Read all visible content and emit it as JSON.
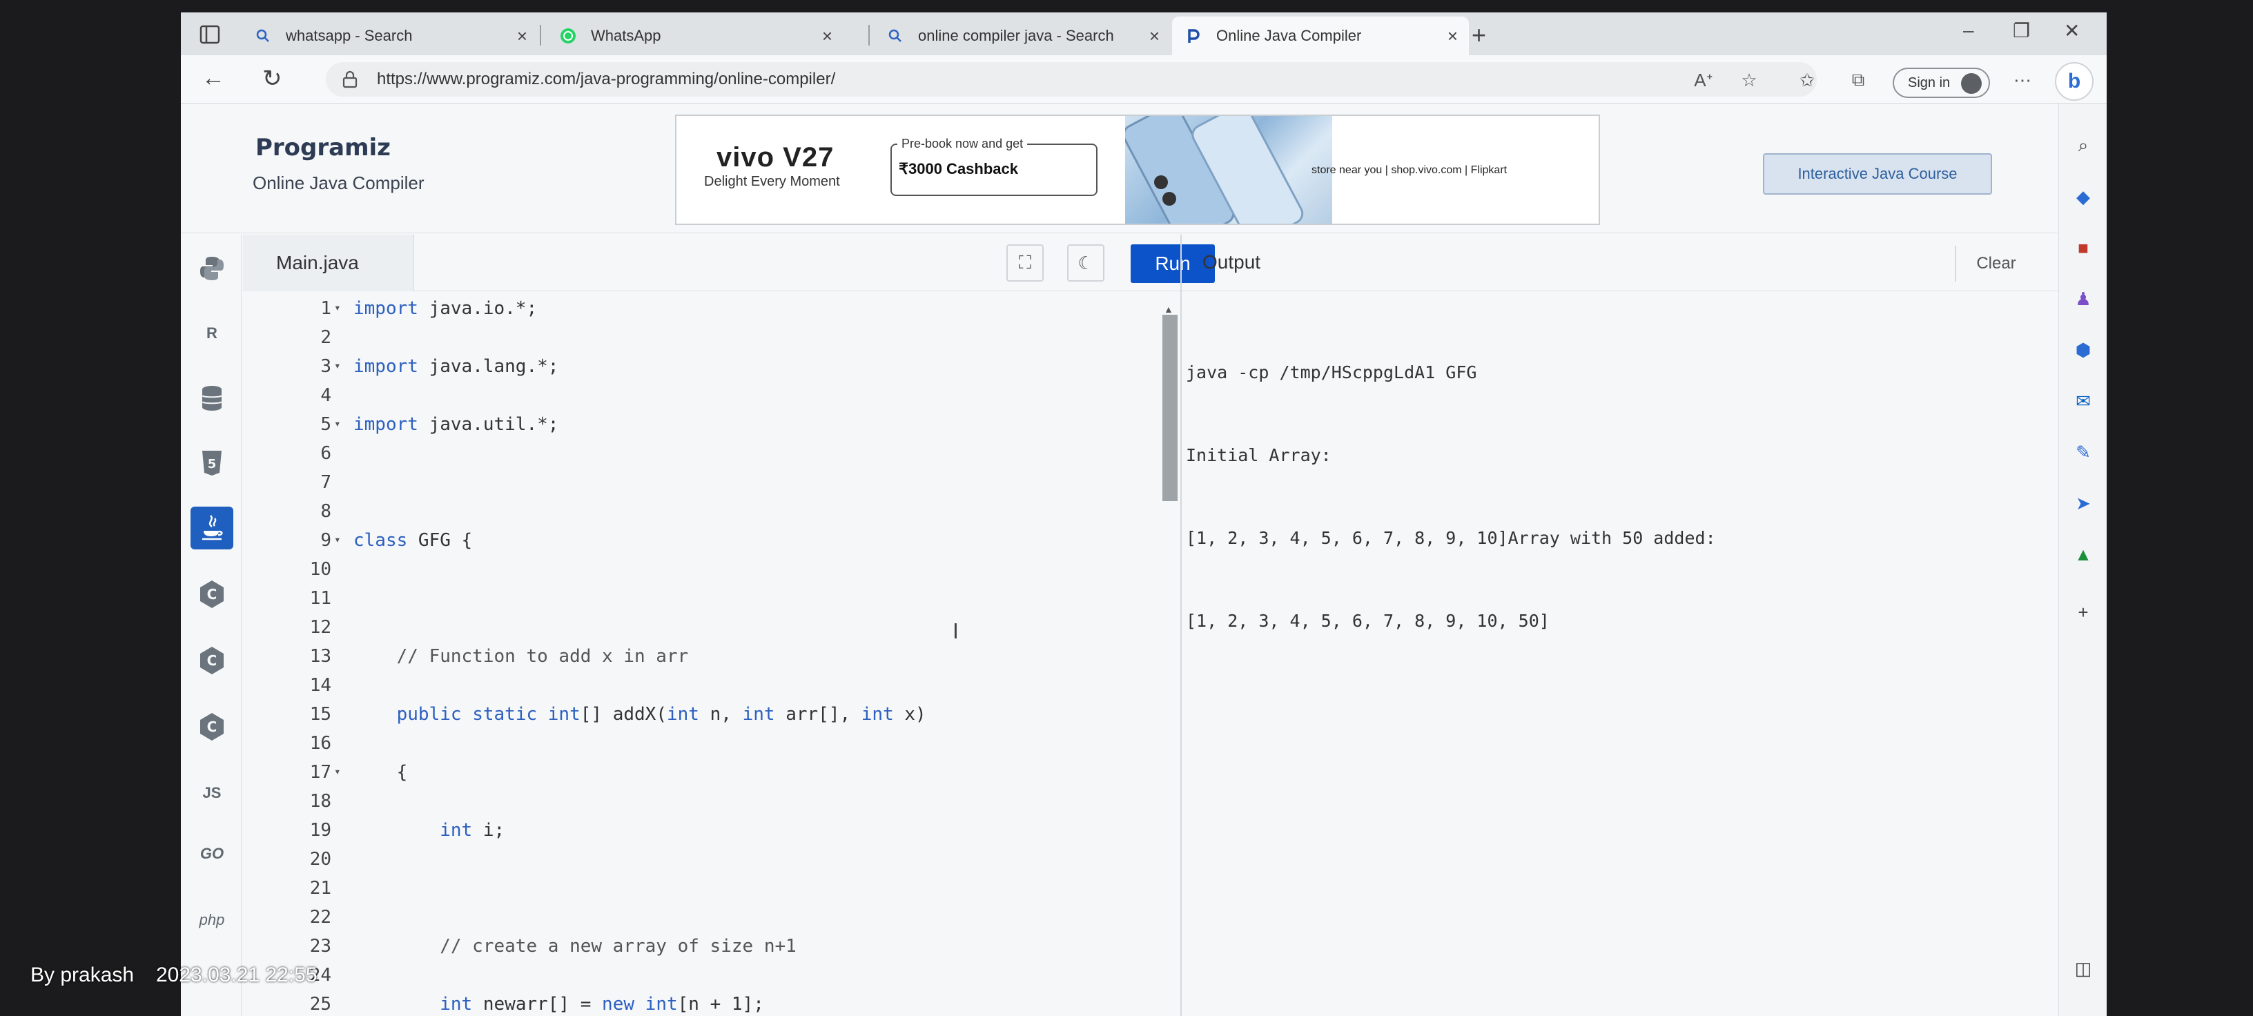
{
  "browser": {
    "tabs": [
      {
        "label": "whatsapp - Search",
        "icon": "search-icon"
      },
      {
        "label": "WhatsApp",
        "icon": "whatsapp-icon"
      },
      {
        "label": "online compiler java - Search",
        "icon": "search-icon"
      },
      {
        "label": "Online Java Compiler",
        "icon": "programiz-icon",
        "active": true
      }
    ],
    "url": "https://www.programiz.com/java-programming/online-compiler/",
    "signin_label": "Sign in"
  },
  "header": {
    "logo": "Programiz",
    "subtitle": "Online Java Compiler",
    "course_button": "Interactive Java Course"
  },
  "ad": {
    "brand": "vivo V27",
    "tagline": "Delight Every Moment",
    "promo_top": "Pre-book now and get",
    "promo_main": "₹3000 Cashback",
    "store": "store near you | shop.vivo.com | Flipkart"
  },
  "languages": [
    "python",
    "r",
    "sql",
    "html",
    "java",
    "c",
    "cpp",
    "csharp",
    "JS",
    "GO",
    "php"
  ],
  "editor": {
    "file_tab": "Main.java",
    "run_label": "Run",
    "lines": [
      {
        "n": "1",
        "fold": true,
        "text": "import java.io.*;"
      },
      {
        "n": "2",
        "fold": false,
        "text": ""
      },
      {
        "n": "3",
        "fold": true,
        "text": "import java.lang.*;"
      },
      {
        "n": "4",
        "fold": false,
        "text": ""
      },
      {
        "n": "5",
        "fold": true,
        "text": "import java.util.*;"
      },
      {
        "n": "6",
        "fold": false,
        "text": ""
      },
      {
        "n": "7",
        "fold": false,
        "text": ""
      },
      {
        "n": "8",
        "fold": false,
        "text": ""
      },
      {
        "n": "9",
        "fold": true,
        "text": "class GFG {"
      },
      {
        "n": "10",
        "fold": false,
        "text": ""
      },
      {
        "n": "11",
        "fold": false,
        "text": ""
      },
      {
        "n": "12",
        "fold": false,
        "text": ""
      },
      {
        "n": "13",
        "fold": false,
        "text": "    // Function to add x in arr"
      },
      {
        "n": "14",
        "fold": false,
        "text": ""
      },
      {
        "n": "15",
        "fold": false,
        "text": "    public static int[] addX(int n, int arr[], int x)"
      },
      {
        "n": "16",
        "fold": false,
        "text": ""
      },
      {
        "n": "17",
        "fold": true,
        "text": "    {"
      },
      {
        "n": "18",
        "fold": false,
        "text": ""
      },
      {
        "n": "19",
        "fold": false,
        "text": "        int i;"
      },
      {
        "n": "20",
        "fold": false,
        "text": ""
      },
      {
        "n": "21",
        "fold": false,
        "text": ""
      },
      {
        "n": "22",
        "fold": false,
        "text": ""
      },
      {
        "n": "23",
        "fold": false,
        "text": "        // create a new array of size n+1"
      },
      {
        "n": "24",
        "fold": false,
        "text": ""
      },
      {
        "n": "25",
        "fold": false,
        "text": "        int newarr[] = new int[n + 1];"
      }
    ]
  },
  "output": {
    "title": "Output",
    "clear_label": "Clear",
    "lines": [
      "java -cp /tmp/HScppgLdA1 GFG",
      "Initial Array:",
      "[1, 2, 3, 4, 5, 6, 7, 8, 9, 10]Array with 50 added:",
      "[1, 2, 3, 4, 5, 6, 7, 8, 9, 10, 50]"
    ]
  },
  "watermark": {
    "author": "By prakash",
    "timestamp": "2023.03.21 22:55"
  }
}
